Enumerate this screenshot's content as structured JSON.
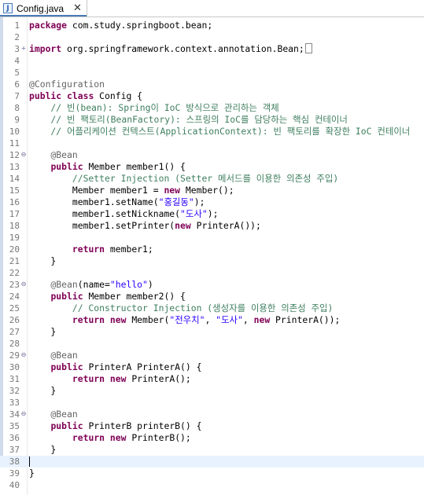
{
  "tab": {
    "title": "Config.java",
    "close": "✕",
    "icon": "J"
  },
  "lines": [
    {
      "n": "1",
      "f": "",
      "s": [
        [
          "kw",
          "package"
        ],
        [
          "",
          "com.study.springboot.bean;"
        ]
      ]
    },
    {
      "n": "2",
      "f": "",
      "s": []
    },
    {
      "n": "3",
      "f": "+",
      "s": [
        [
          "kw",
          "import"
        ],
        [
          "",
          "org.springframework.context.annotation.Bean;"
        ]
      ],
      "box": true
    },
    {
      "n": "4",
      "f": "",
      "s": []
    },
    {
      "n": "5",
      "f": "",
      "s": []
    },
    {
      "n": "6",
      "f": "",
      "s": [
        [
          "an",
          "@Configuration"
        ]
      ]
    },
    {
      "n": "7",
      "f": "",
      "s": [
        [
          "kw",
          "public"
        ],
        [
          "",
          " "
        ],
        [
          "kw",
          "class"
        ],
        [
          "",
          "",
          " Config {"
        ]
      ]
    },
    {
      "n": "8",
      "f": "",
      "s": [
        [
          "",
          ""
        ],
        [
          "cm",
          "    // 빈(bean): Spring이 IoC 방식으로 관리하는 객체"
        ]
      ]
    },
    {
      "n": "9",
      "f": "",
      "s": [
        [
          "cm",
          "    // 빈 팩토리(BeanFactory): 스프링의 IoC를 담당하는 핵심 컨테이너"
        ]
      ]
    },
    {
      "n": "10",
      "f": "",
      "s": [
        [
          "cm",
          "    // 어플리케이션 컨텍스트(ApplicationContext): 빈 팩토리를 확장한 IoC 컨테이너"
        ]
      ]
    },
    {
      "n": "11",
      "f": "",
      "s": []
    },
    {
      "n": "12",
      "f": "⊖",
      "s": [
        [
          "an",
          "    @Bean"
        ]
      ]
    },
    {
      "n": "13",
      "f": "",
      "s": [
        [
          "",
          "    "
        ],
        [
          "kw",
          "public"
        ],
        [
          "",
          " Member member1() {"
        ]
      ]
    },
    {
      "n": "14",
      "f": "",
      "s": [
        [
          "cm",
          "        //Setter Injection (Setter 메서드를 이용한 의존성 주입)"
        ]
      ]
    },
    {
      "n": "15",
      "f": "",
      "s": [
        [
          "",
          "        Member member1 = "
        ],
        [
          "kw",
          "new"
        ],
        [
          "",
          " Member();"
        ]
      ]
    },
    {
      "n": "16",
      "f": "",
      "s": [
        [
          "",
          "        member1.setName("
        ],
        [
          "st",
          "\"홍길동\""
        ],
        [
          "",
          ");"
        ]
      ]
    },
    {
      "n": "17",
      "f": "",
      "s": [
        [
          "",
          "        member1.setNickname("
        ],
        [
          "st",
          "\"도사\""
        ],
        [
          "",
          ");"
        ]
      ]
    },
    {
      "n": "18",
      "f": "",
      "s": [
        [
          "",
          "        member1.setPrinter("
        ],
        [
          "kw",
          "new"
        ],
        [
          "",
          " PrinterA());"
        ]
      ]
    },
    {
      "n": "19",
      "f": "",
      "s": []
    },
    {
      "n": "20",
      "f": "",
      "s": [
        [
          "",
          "        "
        ],
        [
          "kw",
          "return"
        ],
        [
          "",
          " member1;"
        ]
      ]
    },
    {
      "n": "21",
      "f": "",
      "s": [
        [
          "",
          "    }"
        ]
      ]
    },
    {
      "n": "22",
      "f": "",
      "s": []
    },
    {
      "n": "23",
      "f": "⊖",
      "s": [
        [
          "an",
          "    @Bean"
        ],
        [
          "",
          "(name="
        ],
        [
          "st",
          "\"hello\""
        ],
        [
          "",
          ")"
        ]
      ]
    },
    {
      "n": "24",
      "f": "",
      "s": [
        [
          "",
          "    "
        ],
        [
          "kw",
          "public"
        ],
        [
          "",
          " Member member2() {"
        ]
      ]
    },
    {
      "n": "25",
      "f": "",
      "s": [
        [
          "cm",
          "        // Constructor Injection (생성자를 이용한 의존성 주입)"
        ]
      ]
    },
    {
      "n": "26",
      "f": "",
      "s": [
        [
          "",
          "        "
        ],
        [
          "kw",
          "return"
        ],
        [
          "",
          " "
        ],
        [
          "kw",
          "new"
        ],
        [
          "",
          " Member("
        ],
        [
          "st",
          "\"전우치\""
        ],
        [
          "",
          ", "
        ],
        [
          "st",
          "\"도사\""
        ],
        [
          "",
          ", "
        ],
        [
          "kw",
          "new"
        ],
        [
          "",
          " PrinterA());"
        ]
      ]
    },
    {
      "n": "27",
      "f": "",
      "s": [
        [
          "",
          "    }"
        ]
      ]
    },
    {
      "n": "28",
      "f": "",
      "s": []
    },
    {
      "n": "29",
      "f": "⊖",
      "s": [
        [
          "an",
          "    @Bean"
        ]
      ]
    },
    {
      "n": "30",
      "f": "",
      "s": [
        [
          "",
          "    "
        ],
        [
          "kw",
          "public"
        ],
        [
          "",
          " PrinterA PrinterA() {"
        ]
      ]
    },
    {
      "n": "31",
      "f": "",
      "s": [
        [
          "",
          "        "
        ],
        [
          "kw",
          "return"
        ],
        [
          "",
          " "
        ],
        [
          "kw",
          "new"
        ],
        [
          "",
          " PrinterA();"
        ]
      ]
    },
    {
      "n": "32",
      "f": "",
      "s": [
        [
          "",
          "    }"
        ]
      ]
    },
    {
      "n": "33",
      "f": "",
      "s": []
    },
    {
      "n": "34",
      "f": "⊖",
      "s": [
        [
          "an",
          "    @Bean"
        ]
      ]
    },
    {
      "n": "35",
      "f": "",
      "s": [
        [
          "",
          "    "
        ],
        [
          "kw",
          "public"
        ],
        [
          "",
          " PrinterB printerB() {"
        ]
      ]
    },
    {
      "n": "36",
      "f": "",
      "s": [
        [
          "",
          "        "
        ],
        [
          "kw",
          "return"
        ],
        [
          "",
          " "
        ],
        [
          "kw",
          "new"
        ],
        [
          "",
          " PrinterB();"
        ]
      ]
    },
    {
      "n": "37",
      "f": "",
      "s": [
        [
          "",
          "    }"
        ]
      ]
    },
    {
      "n": "38",
      "f": "",
      "s": [],
      "current": true
    },
    {
      "n": "39",
      "f": "",
      "s": [
        [
          "",
          "}"
        ]
      ]
    },
    {
      "n": "40",
      "f": "",
      "s": []
    }
  ]
}
